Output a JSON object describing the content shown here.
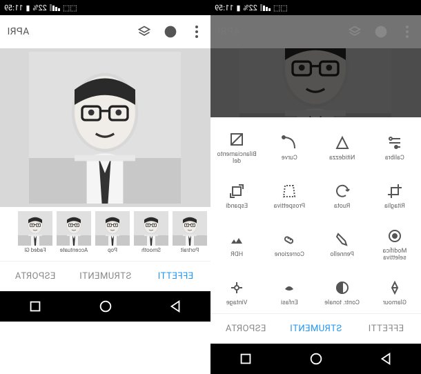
{
  "status": {
    "battery": "22%",
    "time": "11:59"
  },
  "appbar": {
    "open": "APRI"
  },
  "tabs": {
    "effects": "EFFETTI",
    "tools": "STRUMENTI",
    "export": "ESPORTA"
  },
  "filters": [
    {
      "label": "Portrait"
    },
    {
      "label": "Smooth"
    },
    {
      "label": "Pop"
    },
    {
      "label": "Accentuate"
    },
    {
      "label": "Faded Gl"
    }
  ],
  "tools": [
    {
      "label": "Calibra",
      "icon": "tune"
    },
    {
      "label": "Nitidezza",
      "icon": "triangle"
    },
    {
      "label": "Curve",
      "icon": "curve"
    },
    {
      "label": "Bilanciamento del",
      "icon": "wb"
    },
    {
      "label": "Ritaglia",
      "icon": "crop"
    },
    {
      "label": "Ruota",
      "icon": "rotate"
    },
    {
      "label": "Prospettiva",
      "icon": "perspective"
    },
    {
      "label": "Espandi",
      "icon": "expand"
    },
    {
      "label": "Modifica selettiva",
      "icon": "selective"
    },
    {
      "label": "Pennello",
      "icon": "brush"
    },
    {
      "label": "Correzione",
      "icon": "heal"
    },
    {
      "label": "HDR",
      "icon": "hdr"
    },
    {
      "label": "Glamour",
      "icon": "glamour"
    },
    {
      "label": "Contr. tonale",
      "icon": "tonal"
    },
    {
      "label": "Enfasi",
      "icon": "drama"
    },
    {
      "label": "Vintage",
      "icon": "vintage"
    },
    {
      "label": "",
      "icon": "misc1"
    },
    {
      "label": "",
      "icon": "misc2"
    },
    {
      "label": "",
      "icon": "misc3"
    },
    {
      "label": "",
      "icon": "misc4"
    }
  ]
}
